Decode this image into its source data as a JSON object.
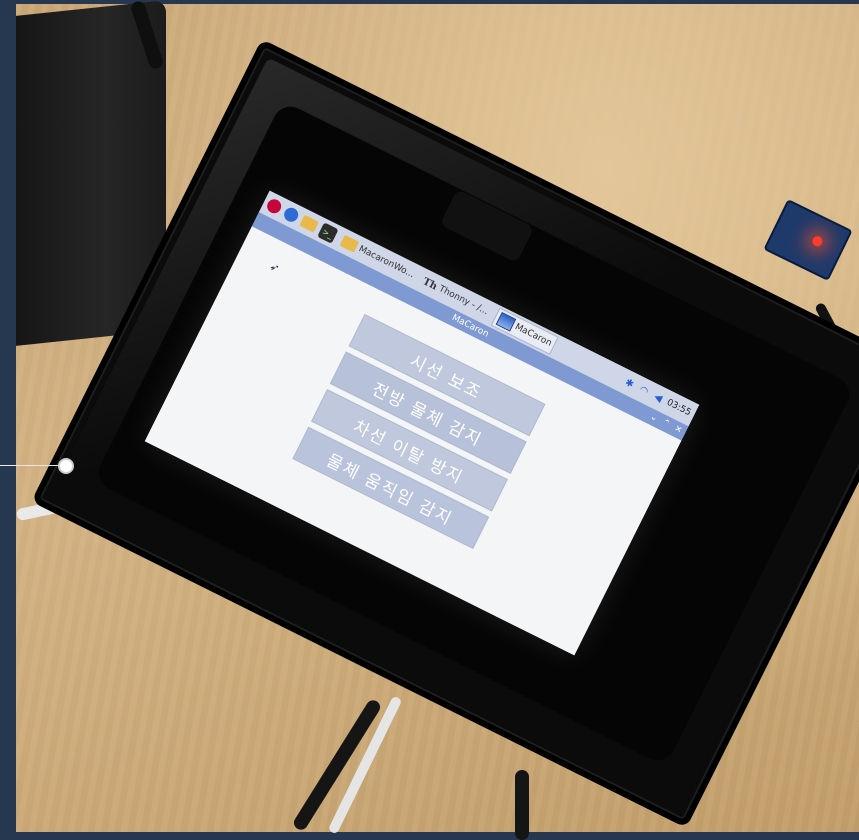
{
  "taskbar": {
    "items": [
      {
        "label": "MacaronWo...",
        "icon": "folder-icon"
      },
      {
        "label": "Thonny - /...",
        "icon": "thonny-icon"
      },
      {
        "label": "MaCaron",
        "icon": "app-window-icon",
        "active": true
      }
    ],
    "tray_icons": [
      "bluetooth-icon",
      "wifi-icon",
      "volume-icon"
    ],
    "clock": "03:55"
  },
  "window": {
    "title": "MaCaron",
    "controls": [
      "⌄",
      "⌃",
      "✕"
    ]
  },
  "menu": {
    "buttons": [
      {
        "label": "시선 보조"
      },
      {
        "label": "전방 물체 감지"
      },
      {
        "label": "차선 이탈 방지"
      },
      {
        "label": "물체 움직임 감지"
      }
    ]
  },
  "colors": {
    "taskbar": "#cfd6e8",
    "titlebar": "#7f99d3",
    "button": "#bfc8dc",
    "sensor_led": "#ff3b2a"
  }
}
